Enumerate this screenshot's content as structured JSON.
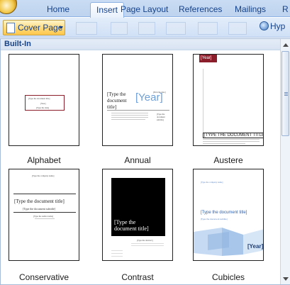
{
  "ribbon": {
    "tabs": [
      {
        "label": "Home"
      },
      {
        "label": "Insert"
      },
      {
        "label": "Page Layout"
      },
      {
        "label": "References"
      },
      {
        "label": "Mailings"
      },
      {
        "label": "R"
      }
    ],
    "active_tab": "Insert",
    "cover_page_label": "Cover Page",
    "hyperlink_label": "Hyp"
  },
  "gallery": {
    "section_title": "Built-In",
    "items": [
      {
        "name": "Alphabet",
        "preview": {
          "title": "[Type the document title]",
          "subtitle": "[Year]",
          "line": "[Type the date]"
        }
      },
      {
        "name": "Annual",
        "preview": {
          "date": "[Pick the date]",
          "title": "[Type the document title]",
          "year": "[Year]",
          "side": "[Type the document subtitle]"
        }
      },
      {
        "name": "Austere",
        "preview": {
          "year": "[Year]",
          "title": "[TYPE THE DOCUMENT TITLE]"
        }
      },
      {
        "name": "Conservative",
        "preview": {
          "company": "[Type the company name]",
          "title": "[Type the document title]",
          "subtitle": "[Type the document subtitle]",
          "author": "[Type the author name]"
        }
      },
      {
        "name": "Contrast",
        "preview": {
          "title": "[Type the document title]",
          "subtitle": "[Type the abstract]"
        }
      },
      {
        "name": "Cubicles",
        "preview": {
          "company": "[Type the company name]",
          "title": "[Type the document title]",
          "subtitle": "[Type the document subtitle]",
          "year": "[Year]"
        }
      }
    ]
  },
  "colors": {
    "accent_red": "#8b1c2a",
    "accent_blue": "#3b6fc2",
    "contrast_black": "#000000",
    "cubicle_blue": "#a7c6ea"
  }
}
